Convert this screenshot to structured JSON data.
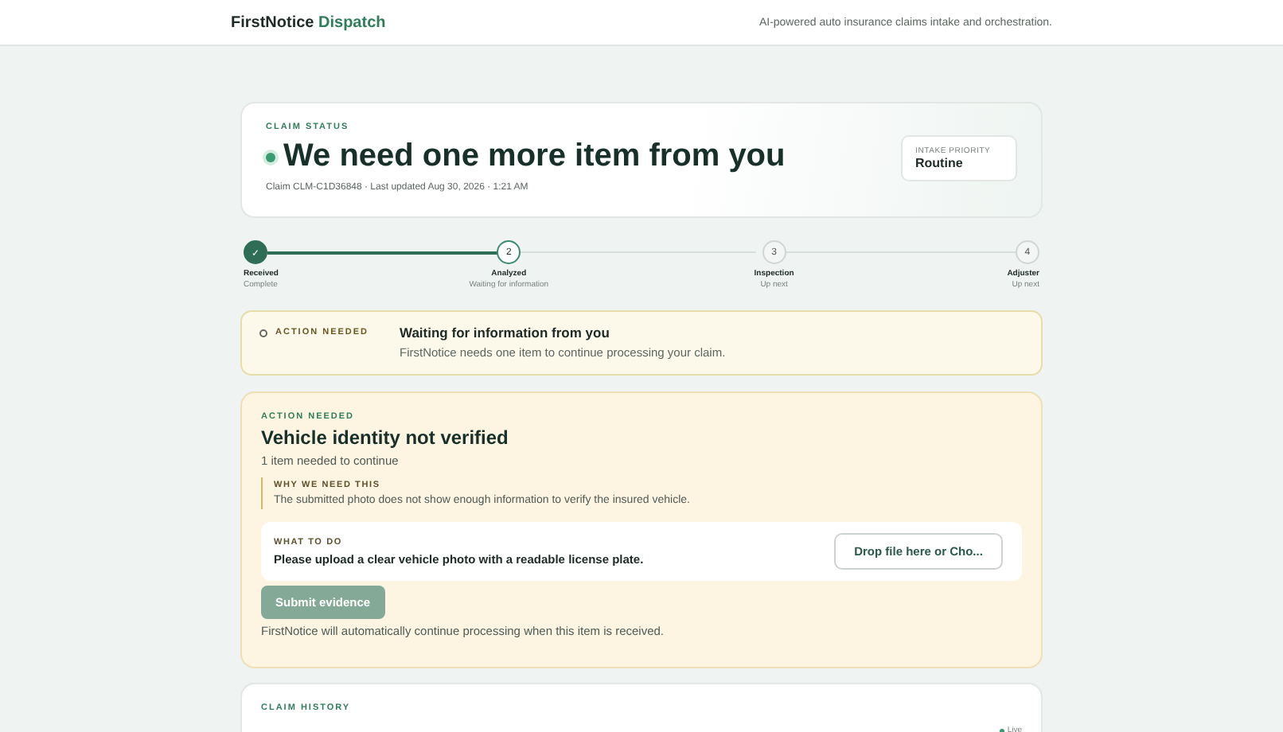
{
  "header": {
    "brand": "FirstNotice",
    "brand_accent": "Dispatch",
    "tagline": "AI-powered auto insurance claims intake and orchestration."
  },
  "status": {
    "eyebrow": "CLAIM STATUS",
    "title": "We need one more item from you",
    "meta": "Claim CLM-C1D36848 · Last updated Aug 30, 2026 · 1:21 AM",
    "priority_label": "INTAKE PRIORITY",
    "priority": "Routine"
  },
  "steps": [
    {
      "marker": "✓",
      "label": "Received",
      "sub": "Complete",
      "done": true,
      "current": false
    },
    {
      "marker": "2",
      "label": "Analyzed",
      "sub": "Waiting for information",
      "done": false,
      "current": true
    },
    {
      "marker": "3",
      "label": "Inspection",
      "sub": "Up next",
      "done": false,
      "current": false
    },
    {
      "marker": "4",
      "label": "Adjuster",
      "sub": "Up next",
      "done": false,
      "current": false
    }
  ],
  "alert": {
    "tag": "ACTION NEEDED",
    "title": "Waiting for information from you",
    "text": "FirstNotice needs one item to continue processing your claim."
  },
  "action": {
    "eyebrow": "ACTION NEEDED",
    "title": "Vehicle identity not verified",
    "count": "1 item needed to continue",
    "why_label": "WHY WE NEED THIS",
    "why": "The submitted photo does not show enough information to verify the insured vehicle.",
    "todo_label": "WHAT TO DO",
    "todo": "Please upload a clear vehicle photo with a readable license plate.",
    "drop": "Drop file here or Cho...",
    "submit": "Submit evidence",
    "submit_disabled": true,
    "note": "FirstNotice will automatically continue processing when this item is received."
  },
  "history": {
    "eyebrow": "CLAIM HISTORY",
    "badge": "Live"
  }
}
